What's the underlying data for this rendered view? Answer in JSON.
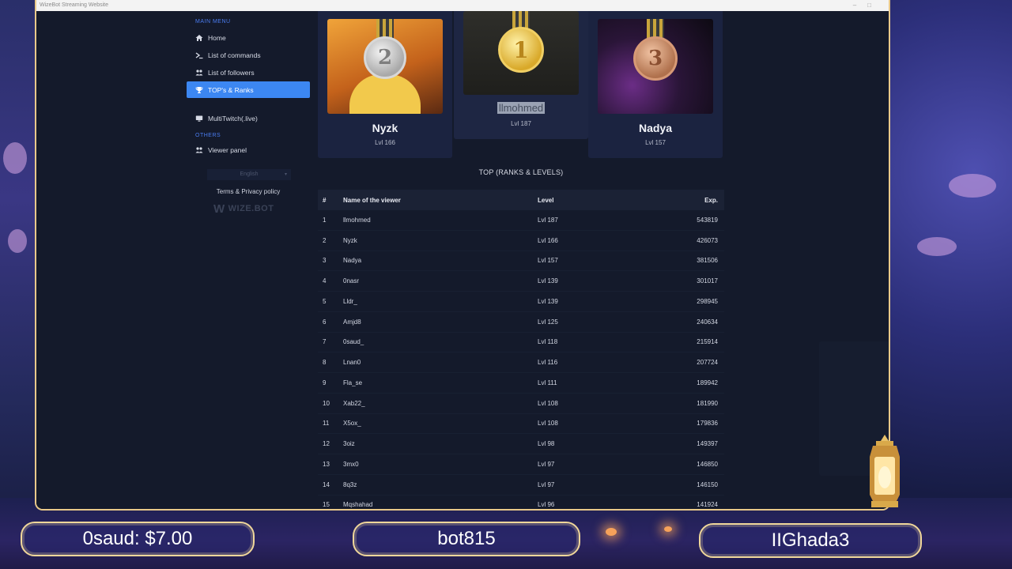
{
  "window": {
    "title": "WizeBot Streaming Website"
  },
  "sidebar": {
    "main_menu_label": "MAIN MENU",
    "items": [
      {
        "label": "Home",
        "icon": "home-icon"
      },
      {
        "label": "List of commands",
        "icon": "terminal-icon"
      },
      {
        "label": "List of followers",
        "icon": "users-icon"
      },
      {
        "label": "TOP's & Ranks",
        "icon": "trophy-icon",
        "active": true
      },
      {
        "label": "MultiTwitch(.live)",
        "icon": "monitor-icon"
      }
    ],
    "others_label": "OTHERS",
    "others_items": [
      {
        "label": "Viewer panel",
        "icon": "users-icon"
      }
    ],
    "language": "English",
    "terms": "Terms & Privacy policy",
    "logo_text": "WIZE.BOT"
  },
  "podium": [
    {
      "rank_badge": "2",
      "name": "Nyzk",
      "level": "Lvl 166",
      "medal_color": "#c9c9c9"
    },
    {
      "rank_badge": "1",
      "name": "llmohmed",
      "level": "Lvl 187",
      "medal_color": "#e3b93f"
    },
    {
      "rank_badge": "3",
      "name": "Nadya",
      "level": "Lvl 157",
      "medal_color": "#c58a62"
    }
  ],
  "top_title": "TOP (RANKS & LEVELS)",
  "table": {
    "headers": {
      "num": "#",
      "name": "Name of the viewer",
      "level": "Level",
      "exp": "Exp."
    },
    "rows": [
      {
        "num": "1",
        "name": "llmohmed",
        "level": "Lvl 187",
        "exp": "543819"
      },
      {
        "num": "2",
        "name": "Nyzk",
        "level": "Lvl 166",
        "exp": "426073"
      },
      {
        "num": "3",
        "name": "Nadya",
        "level": "Lvl 157",
        "exp": "381506"
      },
      {
        "num": "4",
        "name": "0nasr",
        "level": "Lvl 139",
        "exp": "301017"
      },
      {
        "num": "5",
        "name": "Lldr_",
        "level": "Lvl 139",
        "exp": "298945"
      },
      {
        "num": "6",
        "name": "Amjd8",
        "level": "Lvl 125",
        "exp": "240634"
      },
      {
        "num": "7",
        "name": "0saud_",
        "level": "Lvl 118",
        "exp": "215914"
      },
      {
        "num": "8",
        "name": "Lnan0",
        "level": "Lvl 116",
        "exp": "207724"
      },
      {
        "num": "9",
        "name": "Fla_se",
        "level": "Lvl 111",
        "exp": "189942"
      },
      {
        "num": "10",
        "name": "Xab22_",
        "level": "Lvl 108",
        "exp": "181990"
      },
      {
        "num": "11",
        "name": "X5ox_",
        "level": "Lvl 108",
        "exp": "179836"
      },
      {
        "num": "12",
        "name": "3oiz",
        "level": "Lvl 98",
        "exp": "149397"
      },
      {
        "num": "13",
        "name": "3mx0",
        "level": "Lvl 97",
        "exp": "146850"
      },
      {
        "num": "14",
        "name": "8q3z",
        "level": "Lvl 97",
        "exp": "146150"
      },
      {
        "num": "15",
        "name": "Mqshahad",
        "level": "Lvl 96",
        "exp": "141924"
      }
    ]
  },
  "overlay": {
    "donation": "0saud: $7.00",
    "center": "bot815",
    "right": "IIGhada3"
  }
}
